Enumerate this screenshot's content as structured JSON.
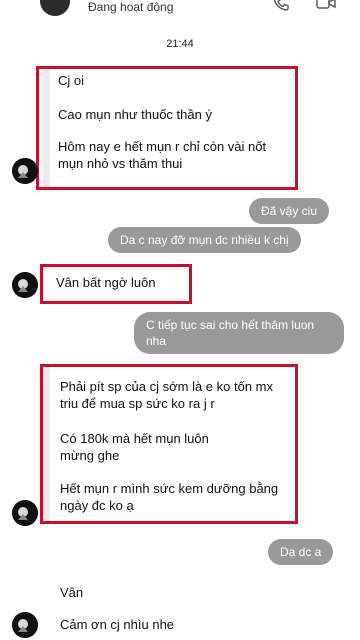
{
  "header": {
    "status": "Đang hoạt động"
  },
  "thread": {
    "timestamp": "21:44"
  },
  "incoming_group_1": [
    "Cj oi",
    "Cao mụn như thuốc thần ý",
    "Hôm nay e hết mụn r chỉ còn vài nốt mụn nhỏ vs thăm thui"
  ],
  "outgoing_1": [
    "Đã vậy ciu",
    "Da c nay đỡ mụn đc nhiều k chị"
  ],
  "incoming_2": "Vân bất ngờ luôn",
  "outgoing_2": "C tiếp tục sai cho hết thâm luon nha",
  "incoming_group_3": [
    "Phải pít sp của cj sớm là e ko tốn mx triu để mua sp sức ko ra j r",
    "Có 180k mà hết mụn luôn mừng ghe",
    "Hết mụn r mình sức kem dưỡng bằng ngày đc ko ạ"
  ],
  "outgoing_3": "Dạ dc a",
  "incoming_group_4": [
    "Vân",
    "Cảm ơn cj nhìu nhe"
  ],
  "colors": {
    "highlight": "#c8102e",
    "outgoing_bubble": "#999999"
  }
}
